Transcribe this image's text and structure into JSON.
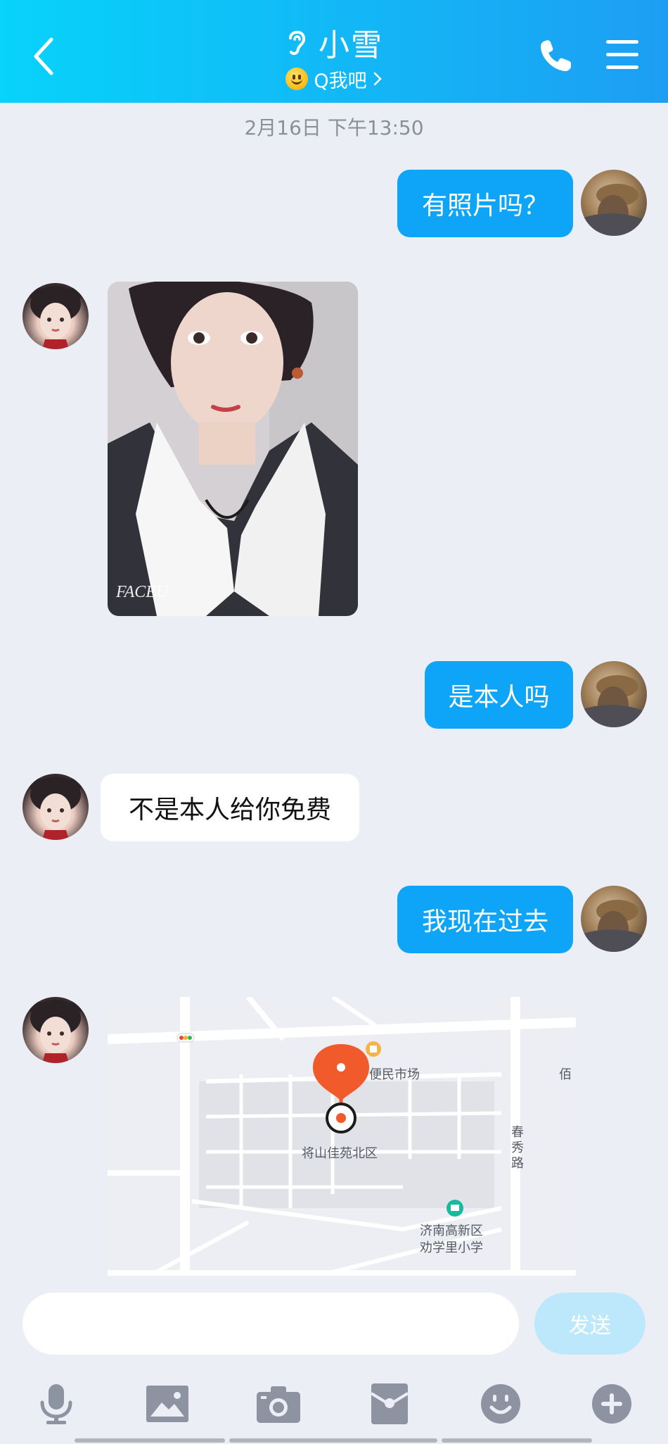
{
  "header": {
    "title": "小雪",
    "subtitle": "Q我吧",
    "icons": {
      "back": "back-chevron-icon",
      "ear": "ear-icon",
      "phone": "phone-icon",
      "menu": "menu-icon"
    }
  },
  "chat": {
    "timestamp": "2月16日 下午13:50",
    "messages": [
      {
        "from": "me",
        "type": "text",
        "text": "有照片吗？"
      },
      {
        "from": "her",
        "type": "image",
        "watermark": "FACEU"
      },
      {
        "from": "me",
        "type": "text",
        "text": "是本人吗"
      },
      {
        "from": "her",
        "type": "text",
        "text": "不是本人给你免费"
      },
      {
        "from": "me",
        "type": "text",
        "text": "我现在过去"
      },
      {
        "from": "her",
        "type": "location"
      }
    ]
  },
  "map": {
    "labels": {
      "market": "便民市场",
      "community": "将山佳苑北区",
      "school_line1": "济南高新区",
      "school_line2": "劝学里小学",
      "road": "春秀路",
      "edge": "佰"
    }
  },
  "input": {
    "placeholder": "",
    "value": "",
    "send_label": "发送"
  },
  "toolbar": [
    "microphone-icon",
    "image-icon",
    "camera-icon",
    "red-packet-icon",
    "emoji-icon",
    "plus-icon"
  ],
  "colors": {
    "header_start": "#07d3fb",
    "header_end": "#1d9ef3",
    "bubble_me": "#0ea4f8",
    "bubble_her": "#ffffff",
    "background": "#eceef6",
    "send_disabled": "#bde8fb",
    "toolbar_icon": "#8e93a2",
    "map_pin": "#f15a2b"
  }
}
